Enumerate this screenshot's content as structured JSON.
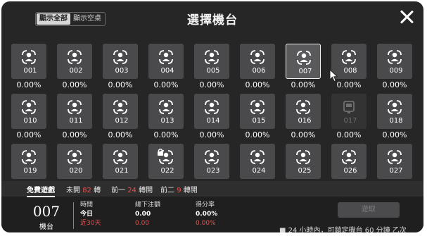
{
  "header": {
    "filter_all": "顯示全部",
    "filter_empty": "顯示空桌",
    "title": "選擇機台"
  },
  "machines": [
    {
      "num": "001",
      "pct": "0.00%",
      "state": "normal"
    },
    {
      "num": "002",
      "pct": "0.00%",
      "state": "normal"
    },
    {
      "num": "003",
      "pct": "0.00%",
      "state": "normal"
    },
    {
      "num": "004",
      "pct": "0.00%",
      "state": "normal"
    },
    {
      "num": "005",
      "pct": "0.00%",
      "state": "normal"
    },
    {
      "num": "006",
      "pct": "0.00%",
      "state": "normal"
    },
    {
      "num": "007",
      "pct": "0.00%",
      "state": "selected"
    },
    {
      "num": "008",
      "pct": "0.00%",
      "state": "normal"
    },
    {
      "num": "009",
      "pct": "0.00%",
      "state": "normal"
    },
    {
      "num": "010",
      "pct": "0.00%",
      "state": "normal"
    },
    {
      "num": "011",
      "pct": "0.00%",
      "state": "normal"
    },
    {
      "num": "012",
      "pct": "0.00%",
      "state": "normal"
    },
    {
      "num": "013",
      "pct": "0.00%",
      "state": "normal"
    },
    {
      "num": "014",
      "pct": "0.00%",
      "state": "normal"
    },
    {
      "num": "015",
      "pct": "0.00%",
      "state": "normal"
    },
    {
      "num": "016",
      "pct": "0.00%",
      "state": "normal"
    },
    {
      "num": "017",
      "pct": "0.00%",
      "state": "unavailable"
    },
    {
      "num": "018",
      "pct": "0.00%",
      "state": "normal"
    },
    {
      "num": "019",
      "pct": "",
      "state": "normal"
    },
    {
      "num": "020",
      "pct": "",
      "state": "normal"
    },
    {
      "num": "021",
      "pct": "",
      "state": "normal"
    },
    {
      "num": "022",
      "pct": "",
      "state": "locked"
    },
    {
      "num": "023",
      "pct": "",
      "state": "normal"
    },
    {
      "num": "024",
      "pct": "",
      "state": "normal"
    },
    {
      "num": "025",
      "pct": "",
      "state": "normal"
    },
    {
      "num": "026",
      "pct": "",
      "state": "normal"
    },
    {
      "num": "027",
      "pct": "",
      "state": "normal"
    }
  ],
  "tabs": {
    "free_game": "免費遊戲",
    "unopened_prefix": "未開",
    "unopened_count": "82",
    "unopened_suffix": "轉",
    "prev1_prefix": "前一",
    "prev1_count": "24",
    "prev1_suffix": "轉開",
    "prev2_prefix": "前二",
    "prev2_count": "9",
    "prev2_suffix": "轉開"
  },
  "selected": {
    "number": "007",
    "label": "機台"
  },
  "stats": {
    "time_header": "時間",
    "today": "今日",
    "last30": "近30天",
    "bet_header": "總下注額",
    "bet_today": "0.00",
    "bet_30": "0.00",
    "rate_header": "得分率",
    "rate_today": "0.00%",
    "rate_30": "0.00%"
  },
  "claim_button": "遊取",
  "note": "■ 24 小時內，可鎖定機台 60 分鐘 乙次",
  "colors": {
    "panel": "#262627",
    "tile": "#4a4a4c",
    "accent_red": "#e8514d"
  }
}
